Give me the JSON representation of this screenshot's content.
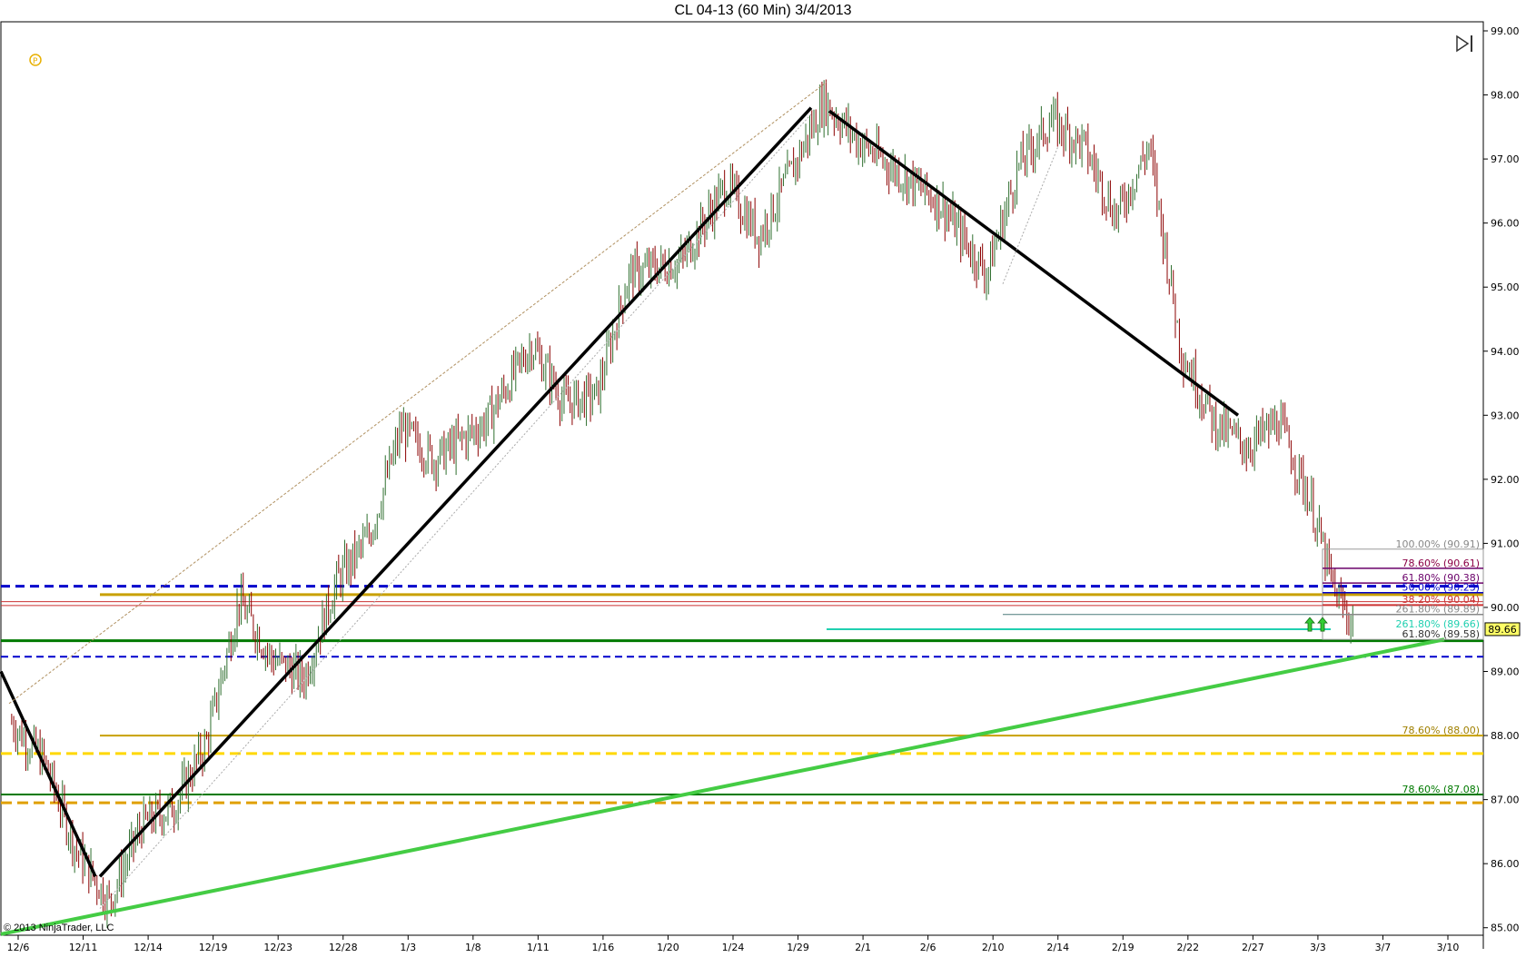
{
  "title": "CL 04-13 (60 Min)  3/4/2013",
  "copyright": "© 2013 NinjaTrader, LLC",
  "icons": {
    "logo": "ninjatrader-logo-icon",
    "scroll_end": "scroll-to-end-icon"
  },
  "colors": {
    "bull_candle": "#2f6f2f",
    "bear_candle": "#8b0000",
    "trendline": "#000000",
    "support_trendline": "#44cc44",
    "blue_dashed": "#0000cc",
    "gold": "#c8a000",
    "yellow_dashed": "#ffd800",
    "orange_dashed": "#e0a000",
    "green_level": "#007a00",
    "red_level": "#cc3333",
    "teal": "#20d0b0",
    "purple": "#6a006a",
    "current_price_bg": "#ffff66"
  },
  "chart_data": {
    "type": "candlestick",
    "title": "CL 04-13 (60 Min)  3/4/2013",
    "ylim": [
      84.5,
      99.0
    ],
    "y_ticks": [
      "85.00",
      "86.00",
      "87.00",
      "88.00",
      "89.00",
      "90.00",
      "91.00",
      "92.00",
      "93.00",
      "94.00",
      "95.00",
      "96.00",
      "97.00",
      "98.00",
      "99.00"
    ],
    "x_ticks": [
      "12/6",
      "12/11",
      "12/14",
      "12/19",
      "12/23",
      "12/28",
      "1/3",
      "1/8",
      "1/11",
      "1/16",
      "1/20",
      "1/24",
      "1/29",
      "2/1",
      "2/6",
      "2/10",
      "2/14",
      "2/19",
      "2/22",
      "2/27",
      "3/3",
      "3/7",
      "3/10"
    ],
    "current_price": "89.66",
    "price_path": [
      [
        "12/6",
        88.2
      ],
      [
        "12/6",
        87.6
      ],
      [
        "12/11",
        86.2
      ],
      [
        "12/11",
        85.4
      ],
      [
        "12/14",
        86.6
      ],
      [
        "12/14",
        86.9
      ],
      [
        "12/19",
        87.9
      ],
      [
        "12/19",
        90.1
      ],
      [
        "12/23",
        89.2
      ],
      [
        "12/23",
        88.9
      ],
      [
        "12/28",
        90.4
      ],
      [
        "12/28",
        91.1
      ],
      [
        "1/3",
        92.8
      ],
      [
        "1/3",
        92.3
      ],
      [
        "1/8",
        92.9
      ],
      [
        "1/11",
        94.1
      ],
      [
        "1/11",
        93.2
      ],
      [
        "1/16",
        93.3
      ],
      [
        "1/16",
        95.2
      ],
      [
        "1/20",
        95.4
      ],
      [
        "1/24",
        96.6
      ],
      [
        "1/24",
        95.8
      ],
      [
        "1/29",
        96.8
      ],
      [
        "1/29",
        97.9
      ],
      [
        "2/1",
        97.3
      ],
      [
        "2/1",
        96.9
      ],
      [
        "2/6",
        96.3
      ],
      [
        "2/10",
        95.2
      ],
      [
        "2/10",
        96.9
      ],
      [
        "2/14",
        97.6
      ],
      [
        "2/14",
        97.2
      ],
      [
        "2/19",
        96.1
      ],
      [
        "2/19",
        97.2
      ],
      [
        "2/22",
        94.0
      ],
      [
        "2/22",
        92.9
      ],
      [
        "2/27",
        92.5
      ],
      [
        "2/27",
        92.9
      ],
      [
        "3/3",
        91.6
      ],
      [
        "3/3",
        90.3
      ],
      [
        "3/3",
        89.66
      ]
    ],
    "fib_labels": [
      {
        "text": "100.00% (90.91)",
        "price": 90.91,
        "color": "#888888"
      },
      {
        "text": "78.60% (90.61)",
        "price": 90.61,
        "color": "#8b0045"
      },
      {
        "text": "61.80% (90.38)",
        "price": 90.38,
        "color": "#6a006a"
      },
      {
        "text": "50.00% (90.23)",
        "price": 90.23,
        "color": "#0000cc"
      },
      {
        "text": "38.20% (90.04)",
        "price": 90.04,
        "color": "#cc3333"
      },
      {
        "text": "261.80% (89.89)",
        "price": 89.89,
        "color": "#888888"
      },
      {
        "text": "261.80% (89.66)",
        "price": 89.66,
        "color": "#20d0b0"
      },
      {
        "text": "61.80% (89.58)",
        "price": 89.5,
        "color": "#333333"
      },
      {
        "text": "78.60% (88.00)",
        "price": 88.0,
        "color": "#a08000"
      },
      {
        "text": "78.60% (87.08)",
        "price": 87.08,
        "color": "#007a00"
      }
    ]
  }
}
